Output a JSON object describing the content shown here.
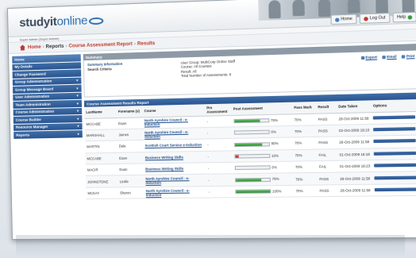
{
  "header": {
    "logo_text": "studyit",
    "logo_accent": "online",
    "buttons": [
      {
        "label": "Home",
        "icon": "house-icon"
      },
      {
        "label": "Log Out",
        "icon": "logout-icon"
      },
      {
        "label": "Help",
        "icon": "help-icon"
      }
    ]
  },
  "userbar": {
    "text": "Super Admin (Super Admin)"
  },
  "breadcrumb": {
    "home": "Home",
    "reports": "Reports",
    "course_report": "Course Assessment Report",
    "results": "Results"
  },
  "sidebar": {
    "items": [
      {
        "label": "Home",
        "arrow": ""
      },
      {
        "label": "My Details",
        "arrow": ""
      },
      {
        "label": "Change Password",
        "arrow": ""
      },
      {
        "label": "Group Administration",
        "arrow": "▼"
      },
      {
        "label": "Group Message Board",
        "arrow": "▼"
      },
      {
        "label": "User Administration",
        "arrow": "▼"
      },
      {
        "label": "Team Administration",
        "arrow": "▼"
      },
      {
        "label": "Course Administration",
        "arrow": "▼"
      },
      {
        "label": "Course Builder",
        "arrow": "▼"
      },
      {
        "label": "Resource Manager",
        "arrow": "▼"
      },
      {
        "label": "Reports",
        "arrow": "▼"
      }
    ]
  },
  "summary": {
    "heading": "Summary",
    "title": "Summary Information",
    "criteria_label": "Search Criteria",
    "criteria": [
      "User Group: MultiCorp Online Staff",
      "Course: All Courses",
      "Result: All",
      "Total Number of Assessments: 8"
    ],
    "actions": {
      "export": "Export",
      "email": "Email",
      "print": "Print"
    }
  },
  "results": {
    "heading": "Course Assessment Results Report",
    "columns": [
      "LastName",
      "Forename (s)",
      "Course",
      "Pre Assessment",
      "Post Assessment",
      "Pass Mark",
      "Result",
      "Date Taken",
      "Options"
    ],
    "rows": [
      {
        "last": "MCCABE",
        "first": "Euan",
        "course": "North Ayrshire Council - e-Induction",
        "pre": "-",
        "post": 75,
        "post_label": "75%",
        "pass": "70%",
        "result": "PASS",
        "date": "28-Oct-2009 11:58",
        "opt": "-"
      },
      {
        "last": "MARSHALL",
        "first": "James",
        "course": "North Ayrshire Council - e-Induction",
        "pre": "-",
        "post": 0,
        "post_label": "0%",
        "pass": "70%",
        "result": "PASS",
        "date": "02-Oct-2009 19:10",
        "opt": "-"
      },
      {
        "last": "MARTIN",
        "first": "Dale",
        "course": "Scottish Court Service e-Induction",
        "pre": "-",
        "post": 80,
        "post_label": "80%",
        "pass": "70%",
        "result": "PASS",
        "date": "28-Oct-2009 11:58",
        "opt": "-"
      },
      {
        "last": "MCCABE",
        "first": "Euan",
        "course": "Business Writing Skills",
        "pre": "-",
        "post": 10,
        "post_label": "10%",
        "pass": "70%",
        "result": "FAIL",
        "date": "01-Oct-2009 16:18",
        "opt": "-"
      },
      {
        "last": "MACIR",
        "first": "Euan",
        "course": "Business Writing Skills",
        "pre": "-",
        "post": 0,
        "post_label": "0%",
        "pass": "70%",
        "result": "FAIL",
        "date": "01-Oct-2009 16:23",
        "opt": "-"
      },
      {
        "last": "JOHNSTONE",
        "first": "Leslie",
        "course": "North Ayrshire Council - e-Induction",
        "pre": "-",
        "post": 75,
        "post_label": "75%",
        "pass": "70%",
        "result": "PASS",
        "date": "28-Oct-2009 11:58",
        "opt": "-"
      },
      {
        "last": "MCKAY",
        "first": "Sharon",
        "course": "North Ayrshire Council - e-Induction",
        "pre": "-",
        "post": 100,
        "post_label": "100%",
        "pass": "70%",
        "result": "PASS",
        "date": "28-Oct-2009 11:58",
        "opt": "-"
      }
    ]
  },
  "colors": {
    "nav_blue": "#2a5490",
    "crumb_red": "#c0392b",
    "bar_green": "#2c8a2c",
    "bar_red": "#b22222"
  }
}
